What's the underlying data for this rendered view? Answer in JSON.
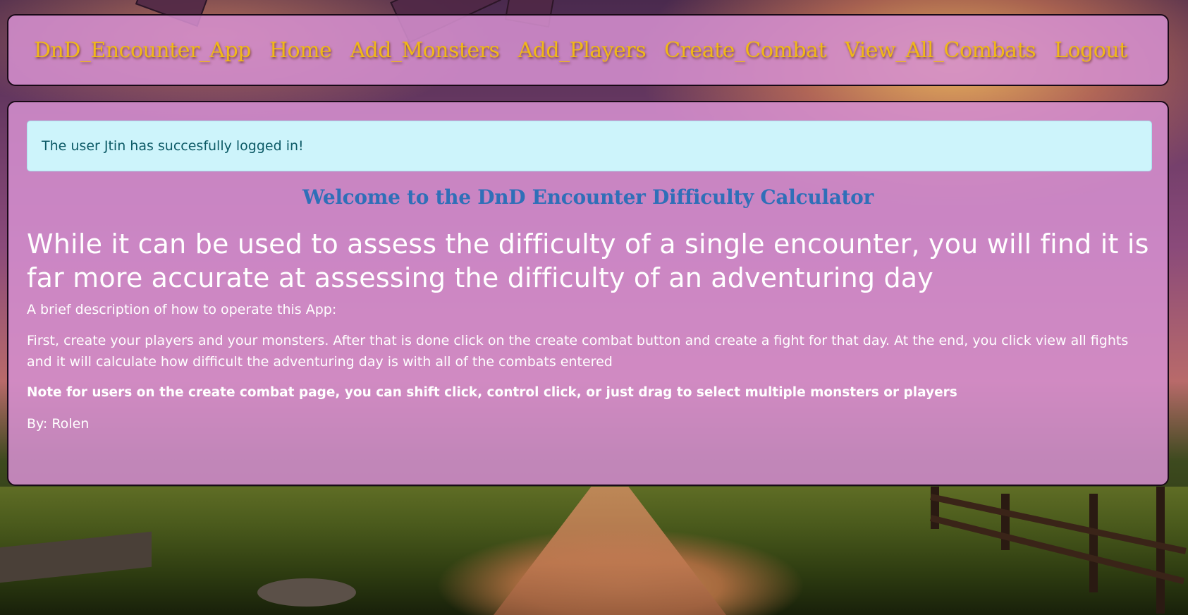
{
  "nav": {
    "brand": "DnD_Encounter_App",
    "links": [
      "Home",
      "Add_Monsters",
      "Add_Players",
      "Create_Combat",
      "View_All_Combats",
      "Logout"
    ]
  },
  "alert": {
    "message": "The user Jtin has succesfully logged in!"
  },
  "main": {
    "welcome": "Welcome to the DnD Encounter Difficulty Calculator",
    "lead": "While it can be used to assess the difficulty of a single encounter, you will find it is far more accurate at assessing the difficulty of an adventuring day",
    "intro": "A brief description of how to operate this App:",
    "instructions": "First, create your players and your monsters. After that is done click on the create combat button and create a fight for that day. At the end, you click view all fights and it will calculate how difficult the adventuring day is with all of the combats entered",
    "note": "Note for users on the create combat page, you can shift click, control click, or just drag to select multiple monsters or players",
    "author": "By: Rolen"
  },
  "colors": {
    "nav_link": "#f0b818",
    "panel_bg": "#d48ece",
    "alert_bg": "#cdf4fb",
    "alert_text": "#0c5a66",
    "welcome_text": "#2f6fb8"
  }
}
